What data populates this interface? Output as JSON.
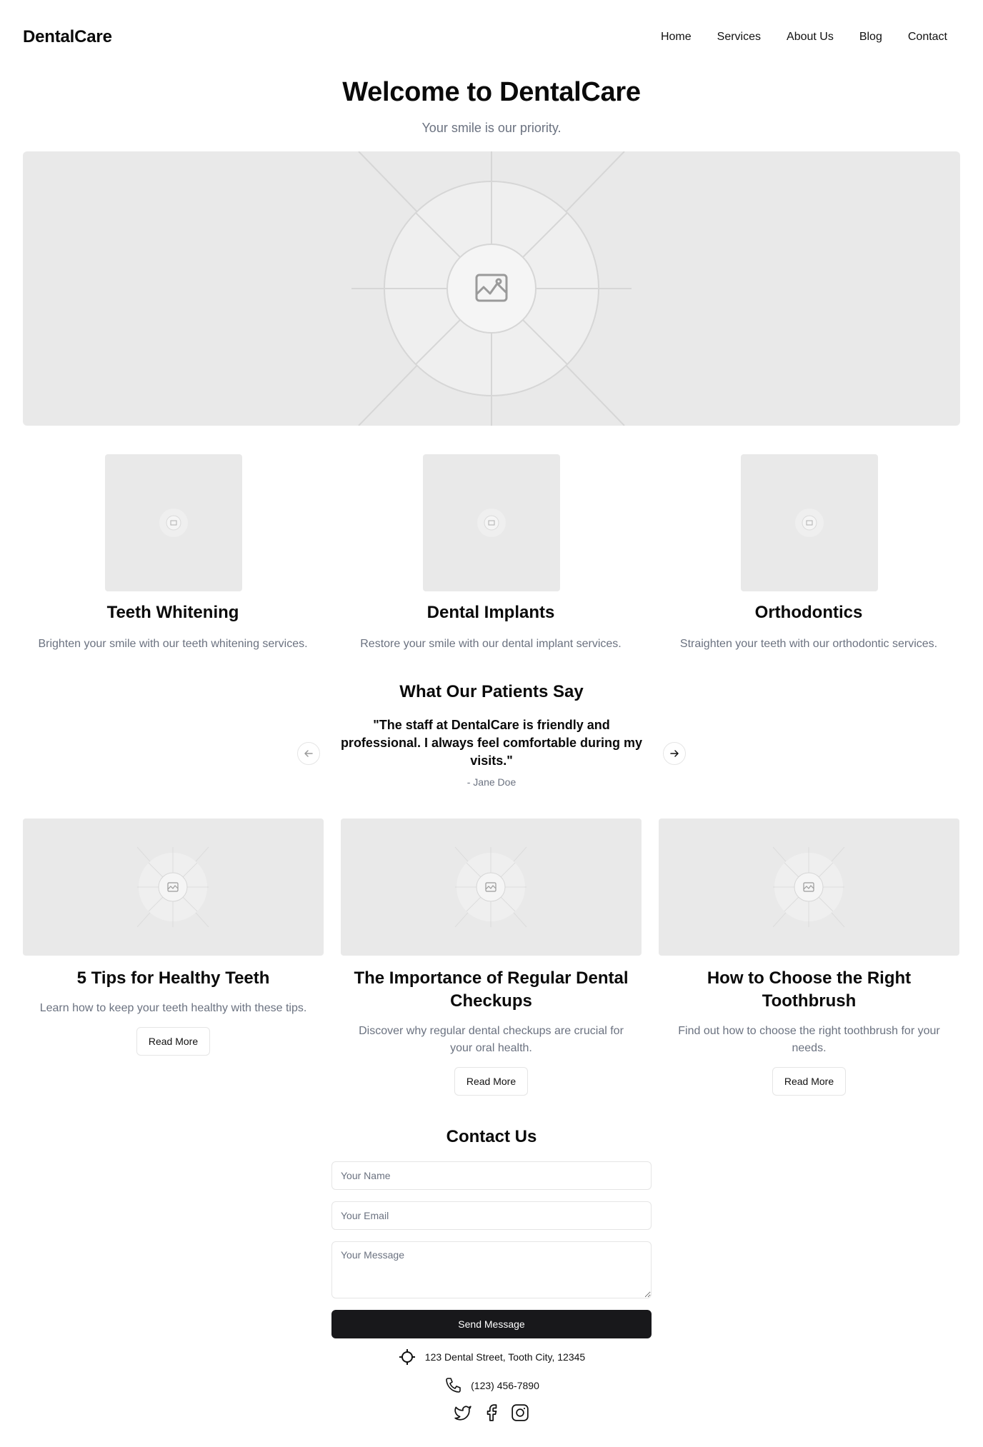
{
  "header": {
    "logo": "DentalCare",
    "nav": [
      "Home",
      "Services",
      "About Us",
      "Blog",
      "Contact"
    ]
  },
  "hero": {
    "title": "Welcome to DentalCare",
    "subtitle": "Your smile is our priority.",
    "image_icon": "image-icon"
  },
  "services": [
    {
      "title": "Teeth Whitening",
      "description": "Brighten your smile with our teeth whitening services."
    },
    {
      "title": "Dental Implants",
      "description": "Restore your smile with our dental implant services."
    },
    {
      "title": "Orthodontics",
      "description": "Straighten your teeth with our orthodontic services."
    }
  ],
  "testimonials": {
    "title": "What Our Patients Say",
    "quote": "\"The staff at DentalCare is friendly and professional. I always feel comfortable during my visits.\"",
    "author": "- Jane Doe",
    "prev_icon": "arrow-left-icon",
    "next_icon": "arrow-right-icon"
  },
  "blog": [
    {
      "title": "5 Tips for Healthy Teeth",
      "description": "Learn how to keep your teeth healthy with these tips.",
      "button": "Read More"
    },
    {
      "title": "The Importance of Regular Dental Checkups",
      "description": "Discover why regular dental checkups are crucial for your oral health.",
      "button": "Read More"
    },
    {
      "title": "How to Choose the Right Toothbrush",
      "description": "Find out how to choose the right toothbrush for your needs.",
      "button": "Read More"
    }
  ],
  "contact": {
    "title": "Contact Us",
    "name_placeholder": "Your Name",
    "email_placeholder": "Your Email",
    "message_placeholder": "Your Message",
    "send_label": "Send Message",
    "address": "123 Dental Street, Tooth City, 12345",
    "phone": "(123) 456-7890",
    "address_icon": "crosshair-icon",
    "phone_icon": "phone-icon",
    "social_icons": [
      "twitter-icon",
      "facebook-icon",
      "instagram-icon"
    ]
  },
  "colors": {
    "text": "#0a0a0a",
    "muted": "#6b7280",
    "placeholder_bg": "#e9e9e9",
    "button_dark": "#18181b",
    "border": "#e5e5e5"
  }
}
